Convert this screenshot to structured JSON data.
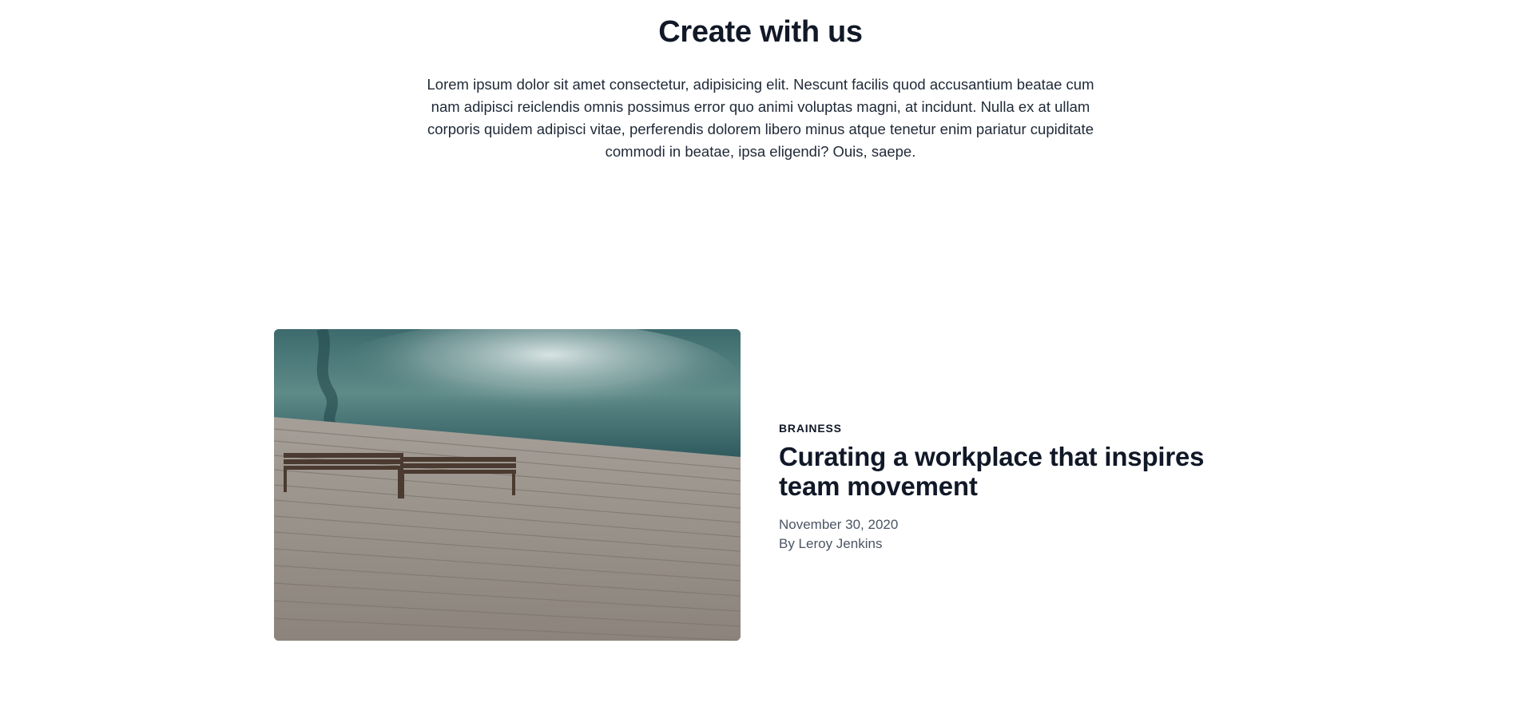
{
  "hero": {
    "title": "Create with us",
    "description": "Lorem ipsum dolor sit amet consectetur, adipisicing elit. Nescunt facilis quod accusantium beatae cum nam adipisci reiclendis omnis possimus error quo animi voluptas magni, at incidunt. Nulla ex at ullam corporis quidem adipisci vitae, perferendis dolorem libero minus atque tenetur enim pariatur cupiditate commodi in beatae, ipsa eligendi? Ouis, saepe."
  },
  "article": {
    "category": "BRAINESS",
    "title": "Curating a workplace that inspires team movement",
    "date": "November 30, 2020",
    "author": "By Leroy Jenkins",
    "image_icon": "photo-water-boardwalk-bench"
  },
  "colors": {
    "text_primary": "#111827",
    "text_secondary": "#4b5563",
    "background": "#ffffff"
  }
}
